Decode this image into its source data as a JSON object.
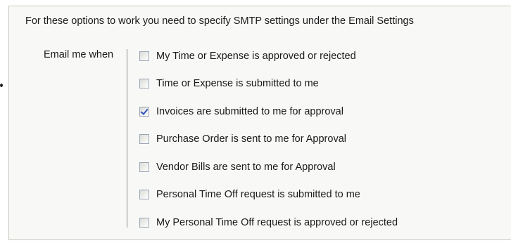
{
  "note": "For these options to work you need to specify SMTP settings under the Email Settings",
  "group_label": "Email me when",
  "options": [
    {
      "label": "My Time or Expense is approved or rejected",
      "checked": false
    },
    {
      "label": "Time or Expense is submitted to me",
      "checked": false
    },
    {
      "label": "Invoices are submitted to me for approval",
      "checked": true
    },
    {
      "label": "Purchase Order is sent to me for Approval",
      "checked": false
    },
    {
      "label": "Vendor Bills are sent to me for Approval",
      "checked": false
    },
    {
      "label": "Personal Time Off request is submitted to me",
      "checked": false
    },
    {
      "label": "My Personal Time Off request is approved or rejected",
      "checked": false
    }
  ],
  "colors": {
    "check_mark": "#2e4fbd",
    "panel_background": "#f8f8f7"
  }
}
